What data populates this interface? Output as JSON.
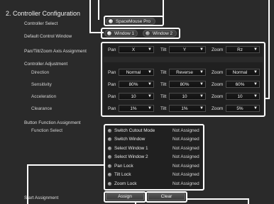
{
  "title": "2. Controller Configuration",
  "labels": {
    "controller_select": "Controller Select",
    "default_window": "Default Control Window",
    "axis_assignment": "Pan/Tilt/Zoom Axis Assignment",
    "controller_adjustment": "Controller Adjustment",
    "direction": "Direction",
    "sensitivity": "Sensitivity",
    "acceleration": "Acceleration",
    "clearance": "Clearance",
    "button_function_assignment": "Button Function Assignment",
    "function_select": "Function Select",
    "start_assignment": "Start Assignment"
  },
  "controller_select": {
    "option": "SpaceMouse Pro",
    "selected": true
  },
  "default_window": {
    "options": [
      "Window 1",
      "Window 2"
    ],
    "selected": "Window 1"
  },
  "axis_labels": {
    "pan": "Pan",
    "tilt": "Tilt",
    "zoom": "Zoom"
  },
  "rows": {
    "assignment": {
      "pan": "X",
      "tilt": "Y",
      "zoom": "Rz"
    },
    "direction": {
      "pan": "Normal",
      "tilt": "Reverse",
      "zoom": "Normal"
    },
    "sensitivity": {
      "pan": "80%",
      "tilt": "80%",
      "zoom": "60%"
    },
    "acceleration": {
      "pan": "10",
      "tilt": "10",
      "zoom": "10"
    },
    "clearance": {
      "pan": "1%",
      "tilt": "1%",
      "zoom": "5%"
    }
  },
  "functions": [
    {
      "name": "Switch Cutout Mode",
      "value": "Not Assigned"
    },
    {
      "name": "Switch Window",
      "value": "Not Assigned"
    },
    {
      "name": "Select Window 1",
      "value": "Not Assigned"
    },
    {
      "name": "Select Window 2",
      "value": "Not Assigned"
    },
    {
      "name": "Pan Lock",
      "value": "Not Assigned"
    },
    {
      "name": "Tilt Lock",
      "value": "Not Assigned"
    },
    {
      "name": "Zoom Lock",
      "value": "Not Assigned"
    }
  ],
  "buttons": {
    "assign": "Assign",
    "clear": "Clear"
  },
  "icons": {
    "dropdown_arrow": "▼"
  }
}
